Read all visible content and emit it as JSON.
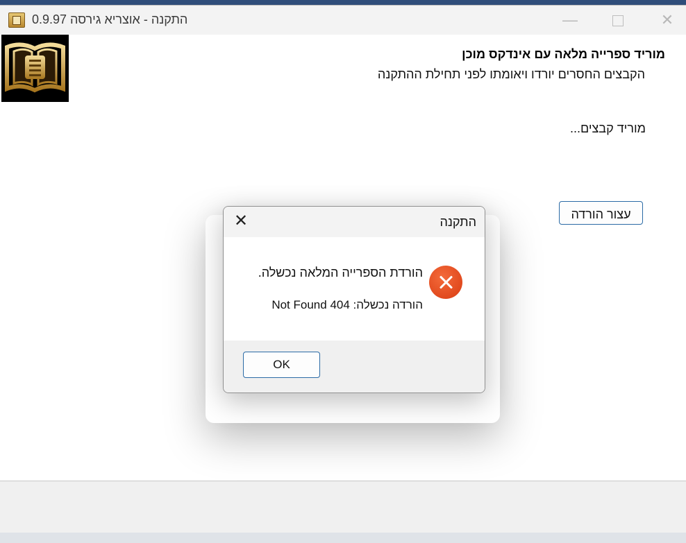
{
  "window": {
    "title": "התקנה - אוצריא גירסה 0.9.97",
    "minimize_glyph": "—",
    "close_glyph": "✕"
  },
  "header": {
    "title": "מוריד ספרייה מלאה עם אינדקס מוכן",
    "subtitle": "הקבצים החסרים יורדו ויאומתו לפני תחילת ההתקנה"
  },
  "main": {
    "status": "מוריד קבצים...",
    "stop_button_label": "עצור הורדה"
  },
  "dialog": {
    "title": "התקנה",
    "close_glyph": "✕",
    "message_line1": "הורדת הספרייה המלאה נכשלה.",
    "message_line2": "הורדה נכשלה: 404 Not Found",
    "ok_label": "OK",
    "icon": "error-icon"
  },
  "colors": {
    "accent_border": "#2a6aa5",
    "error": "#e0461c"
  }
}
